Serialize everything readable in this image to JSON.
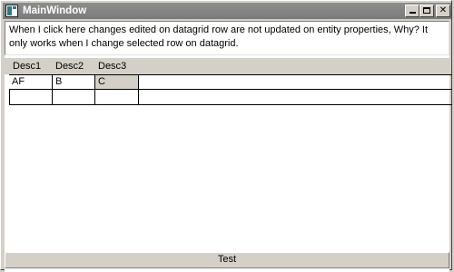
{
  "window": {
    "title": "MainWindow"
  },
  "textblock": {
    "text": "When I click here changes edited on datagrid row are not updated on entity properties, Why? It only works when I change selected row on datagrid."
  },
  "datagrid": {
    "columns": [
      "Desc1",
      "Desc2",
      "Desc3"
    ],
    "rows": [
      [
        "AF",
        "B",
        "C"
      ],
      [
        "",
        "",
        ""
      ]
    ]
  },
  "button": {
    "label": "Test"
  },
  "colors": {
    "window_bg": "#d4d0c8",
    "titlebar_bg": "#808080",
    "selected_cell": "#d4d0c8"
  }
}
